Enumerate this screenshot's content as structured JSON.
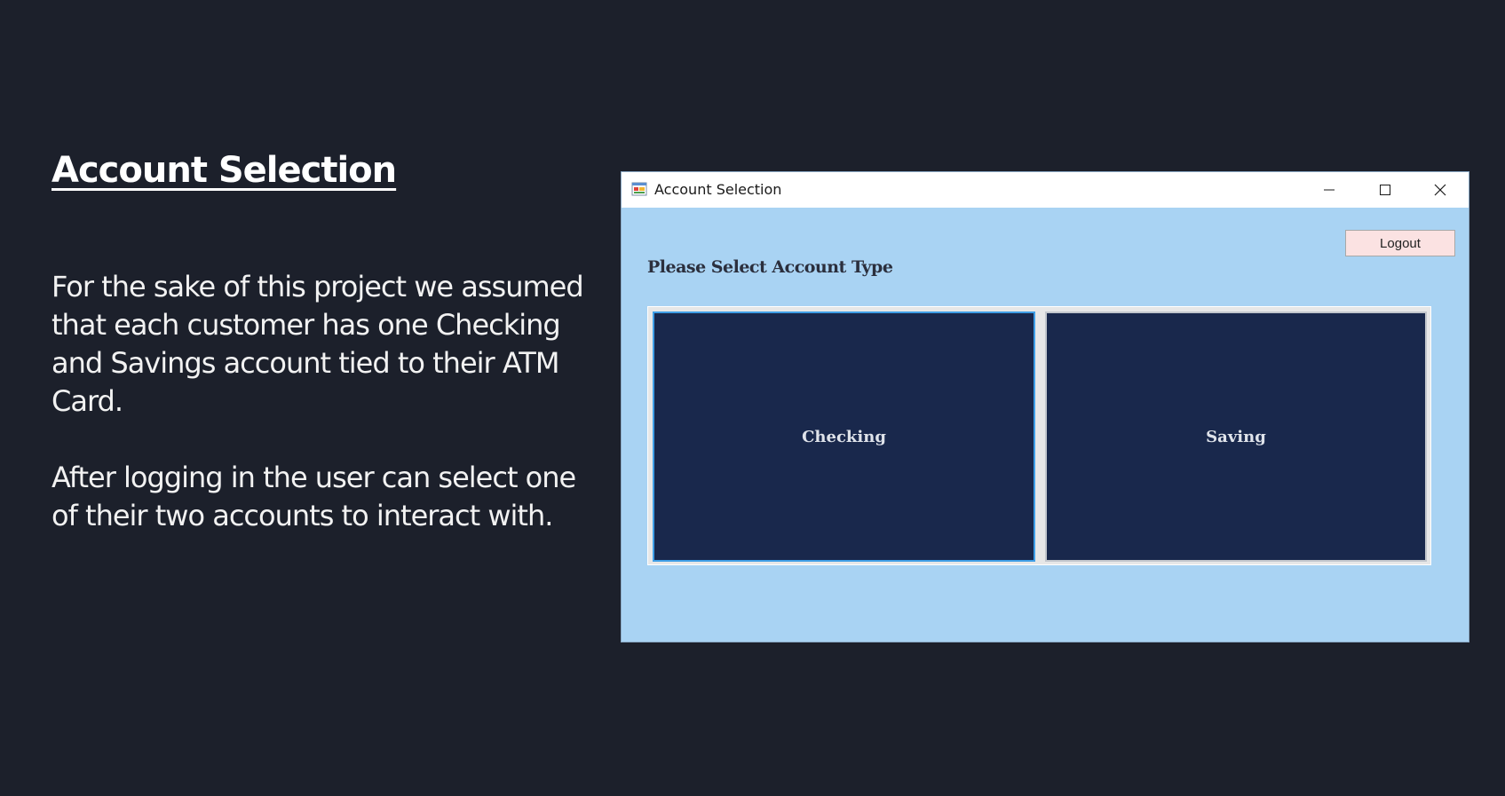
{
  "slide": {
    "title": "Account Selection",
    "paragraphs": [
      "For the sake of this project we assumed that each customer has one Checking and Savings account tied to their ATM Card.",
      "After logging in the user can select one of their two accounts to interact with."
    ]
  },
  "window": {
    "title": "Account Selection",
    "icon": "form-app-icon",
    "controls": [
      "minimize-icon",
      "maximize-icon",
      "close-icon"
    ],
    "logout_label": "Logout",
    "prompt": "Please Select Account Type",
    "buttons": {
      "checking": "Checking",
      "saving": "Saving"
    }
  },
  "colors": {
    "slide_background": "#1c202b",
    "window_background": "#a9d3f3",
    "account_button": "#19284c",
    "logout_button": "#fbe2e2",
    "focus_border": "#3f9ee6"
  }
}
